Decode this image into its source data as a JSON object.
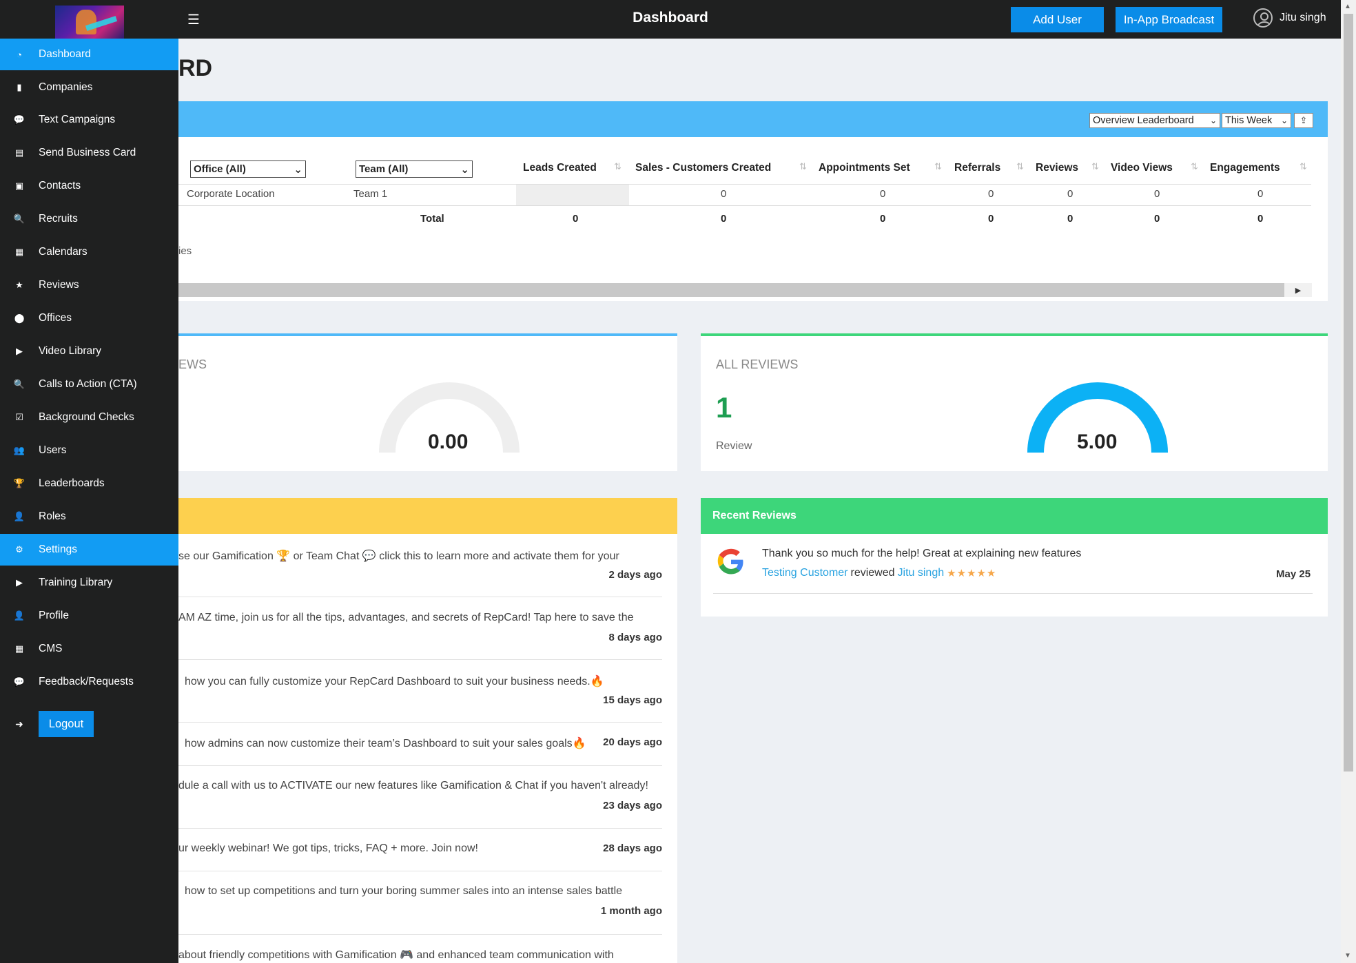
{
  "topbar": {
    "title": "Dashboard",
    "add_user": "Add User",
    "broadcast": "In-App Broadcast",
    "user_name": "Jitu singh"
  },
  "sidebar": {
    "items": [
      {
        "label": "Dashboard",
        "icon": "dashboard-icon",
        "glyph": "◔",
        "active": true
      },
      {
        "label": "Companies",
        "icon": "building-icon",
        "glyph": "▮"
      },
      {
        "label": "Text Campaigns",
        "icon": "chat-icon",
        "glyph": "💬"
      },
      {
        "label": "Send Business Card",
        "icon": "card-icon",
        "glyph": "▤"
      },
      {
        "label": "Contacts",
        "icon": "contacts-icon",
        "glyph": "▣"
      },
      {
        "label": "Recruits",
        "icon": "search-icon",
        "glyph": "🔍"
      },
      {
        "label": "Calendars",
        "icon": "calendar-icon",
        "glyph": "▦"
      },
      {
        "label": "Reviews",
        "icon": "star-icon",
        "glyph": "★"
      },
      {
        "label": "Offices",
        "icon": "map-pin-icon",
        "glyph": "⬤"
      },
      {
        "label": "Video Library",
        "icon": "video-icon",
        "glyph": "▶"
      },
      {
        "label": "Calls to Action (CTA)",
        "icon": "search-plus-icon",
        "glyph": "🔍"
      },
      {
        "label": "Background Checks",
        "icon": "checkbox-icon",
        "glyph": "☑"
      },
      {
        "label": "Users",
        "icon": "users-icon",
        "glyph": "👥"
      },
      {
        "label": "Leaderboards",
        "icon": "trophy-icon",
        "glyph": "🏆"
      },
      {
        "label": "Roles",
        "icon": "role-icon",
        "glyph": "👤"
      },
      {
        "label": "Settings",
        "icon": "gear-icon",
        "glyph": "⚙",
        "active": true
      },
      {
        "label": "Training Library",
        "icon": "youtube-icon",
        "glyph": "▶"
      },
      {
        "label": "Profile",
        "icon": "profile-icon",
        "glyph": "👤"
      },
      {
        "label": "CMS",
        "icon": "grid-icon",
        "glyph": "▦"
      },
      {
        "label": "Feedback/Requests",
        "icon": "comment-icon",
        "glyph": "💬"
      }
    ],
    "logout": "Logout"
  },
  "page": {
    "heading_fragment": "RD"
  },
  "leaderboard": {
    "board_select": "Overview Leaderboard",
    "period_select": "This Week",
    "office_filter": "Office (All)",
    "team_filter": "Team (All)",
    "columns": [
      "Leads Created",
      "Sales - Customers Created",
      "Appointments Set",
      "Referrals",
      "Reviews",
      "Video Views",
      "Engagements"
    ],
    "row": {
      "office": "Corporate Location",
      "team": "Team 1",
      "values": [
        "0",
        "0",
        "0",
        "0",
        "0",
        "0",
        "0"
      ]
    },
    "total_label": "Total",
    "totals": [
      "0",
      "0",
      "0",
      "0",
      "0",
      "0",
      "0"
    ],
    "showing_fragment": "ies"
  },
  "reviews_cards": {
    "left_label_fragment": "EWS",
    "left_gauge": "0.00",
    "left_gauge_fraction": 0,
    "right_label": "ALL REVIEWS",
    "right_count": "1",
    "right_count_label": "Review",
    "right_gauge": "5.00",
    "right_gauge_fraction": 1
  },
  "announcements": [
    {
      "text": "se our Gamification 🏆 or Team Chat 💬 click this to learn more and activate them for your",
      "time": "2 days ago"
    },
    {
      "text": "AM AZ time, join us for all the tips, advantages, and secrets of RepCard! Tap here to save the",
      "time": "8 days ago"
    },
    {
      "text": "how you can fully customize your RepCard Dashboard to suit your business needs.🔥",
      "time": "15 days ago"
    },
    {
      "text": "how admins can now customize their team’s Dashboard to suit your sales goals🔥",
      "time": "20 days ago"
    },
    {
      "text": "dule a call with us to ACTIVATE our new features like Gamification & Chat if you haven't already!",
      "time": "23 days ago"
    },
    {
      "text": "ur weekly webinar! We got tips, tricks, FAQ + more. Join now!",
      "time": "28 days ago"
    },
    {
      "text": "how to set up competitions and turn your boring summer sales into an intense sales battle",
      "time": "1 month ago"
    },
    {
      "text": "about friendly competitions with Gamification 🎮 and enhanced team communication with",
      "time": ""
    }
  ],
  "recent_reviews": {
    "title": "Recent Reviews",
    "items": [
      {
        "text": "Thank you so much for the help! Great at explaining new features",
        "reviewer": "Testing Customer",
        "verb": "reviewed",
        "reviewee": "Jitu singh",
        "stars": "★★★★★",
        "date": "May 25"
      }
    ]
  },
  "colors": {
    "sidebar_bg": "#1f2020",
    "active_blue": "#129cf3",
    "leaderboard_header": "#4fb9f8",
    "announcements_header": "#fdd04e",
    "reviews_header": "#3dd67a",
    "gauge_fill": "#0cb1f5"
  }
}
